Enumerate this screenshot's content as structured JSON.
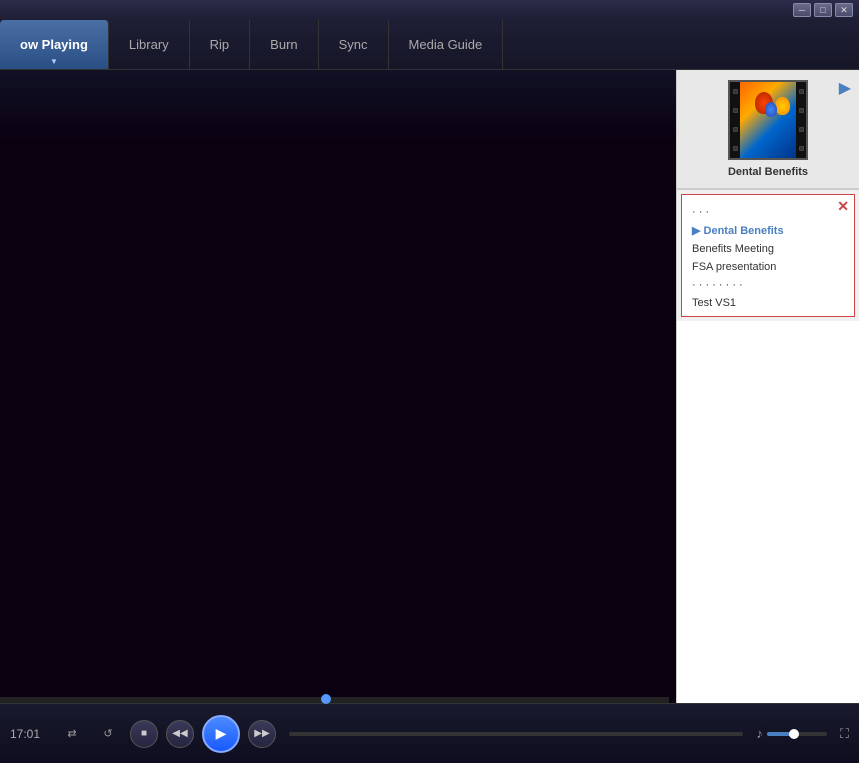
{
  "window": {
    "chrome_buttons": [
      "─",
      "□",
      "✕"
    ]
  },
  "nav": {
    "tabs": [
      {
        "id": "now-playing",
        "label": "ow Playing",
        "active": true
      },
      {
        "id": "library",
        "label": "Library",
        "active": false
      },
      {
        "id": "rip",
        "label": "Rip",
        "active": false
      },
      {
        "id": "burn",
        "label": "Burn",
        "active": false
      },
      {
        "id": "sync",
        "label": "Sync",
        "active": false
      },
      {
        "id": "media-guide",
        "label": "Media Guide",
        "active": false
      }
    ]
  },
  "sidebar": {
    "now_playing_title": "Dental Benefits",
    "arrow_icon": "▶",
    "close_icon": "✕",
    "playlist_items": [
      {
        "id": "item0",
        "label": "· · ·",
        "active": false
      },
      {
        "id": "dental-benefits",
        "label": "Dental Benefits",
        "active": true
      },
      {
        "id": "benefits-meeting",
        "label": "Benefits Meeting",
        "active": false
      },
      {
        "id": "fsa-presentation",
        "label": "FSA presentation",
        "active": false
      },
      {
        "id": "item4",
        "label": "· · · · · · · ·",
        "active": false
      },
      {
        "id": "test-v51",
        "label": "Test VS1",
        "active": false
      }
    ]
  },
  "controls": {
    "time_current": "17:01",
    "shuffle_icon": "⇄",
    "repeat_icon": "↺",
    "stop_icon": "■",
    "prev_icon": "◀◀",
    "play_icon": "▶",
    "next_icon": "▶▶",
    "volume_icon": "♪",
    "fullscreen_icon": "⛶"
  }
}
